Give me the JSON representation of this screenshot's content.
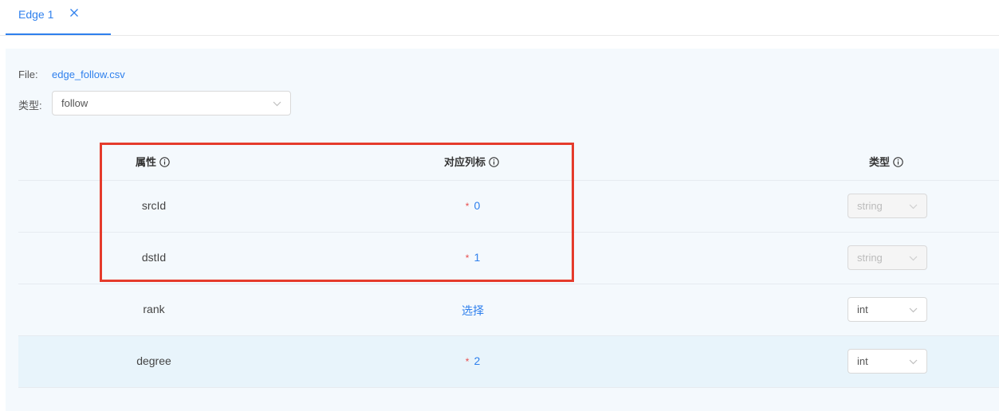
{
  "tabs": [
    {
      "label": "Edge 1",
      "close_icon": "close-icon"
    }
  ],
  "file": {
    "label": "File:",
    "name": "edge_follow.csv"
  },
  "edge_type": {
    "label": "类型:",
    "value": "follow"
  },
  "table": {
    "headers": {
      "property": "属性",
      "column": "对应列标",
      "type": "类型"
    },
    "rows": [
      {
        "property": "srcId",
        "required": "*",
        "column": "0",
        "type": "string"
      },
      {
        "property": "dstId",
        "required": "*",
        "column": "1",
        "type": "string"
      },
      {
        "property": "rank",
        "required": "",
        "column": "选择",
        "type": "int"
      },
      {
        "property": "degree",
        "required": "*",
        "column": "2",
        "type": "int"
      }
    ]
  },
  "colors": {
    "accent": "#2f80ed",
    "required": "#e84f4f",
    "highlight_box": "#e53b2c"
  }
}
